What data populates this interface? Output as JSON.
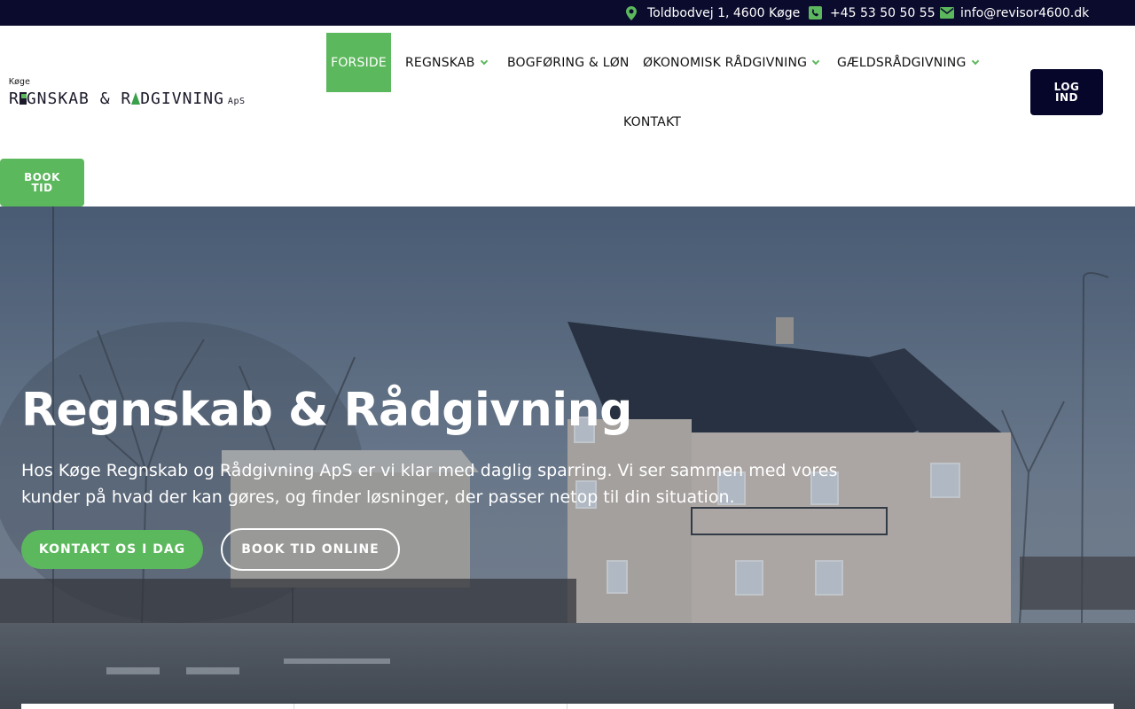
{
  "topbar": {
    "address": "Toldbodvej 1, 4600 Køge",
    "phone": "+45 53 50 50 55",
    "email": "info@revisor4600.dk",
    "icons": [
      "map-marker-icon",
      "phone-icon",
      "envelope-icon"
    ]
  },
  "logo": {
    "small": "Køge",
    "part1": "R",
    "part2": "GNSKAB & R",
    "part3": "DGIVNING",
    "suffix": "ApS"
  },
  "nav": {
    "items": [
      {
        "label": "FORSIDE",
        "active": true,
        "dropdown": false
      },
      {
        "label": "REGNSKAB",
        "active": false,
        "dropdown": true
      },
      {
        "label": "BOGFØRING & LØN",
        "active": false,
        "dropdown": false
      },
      {
        "label": "ØKONOMISK RÅDGIVNING",
        "active": false,
        "dropdown": true
      },
      {
        "label": "GÆLDSRÅDGIVNING",
        "active": false,
        "dropdown": true
      },
      {
        "label": "KONTAKT",
        "active": false,
        "dropdown": false
      }
    ],
    "login_label": "LOG IND",
    "book_label": "BOOK TID"
  },
  "hero": {
    "title": "Regnskab & Rådgivning",
    "text": "Hos Køge Regnskab og Rådgivning ApS er vi klar med daglig sparring. Vi ser sammen med vores kunder på hvad der kan gøres, og finder løsninger, der passer netop til din situation.",
    "cta_primary": "KONTAKT OS I DAG",
    "cta_secondary": "BOOK TID ONLINE"
  },
  "colors": {
    "topbar_bg": "#0b0b2e",
    "accent_green": "#5cb85c",
    "login_bg": "#06062a"
  }
}
